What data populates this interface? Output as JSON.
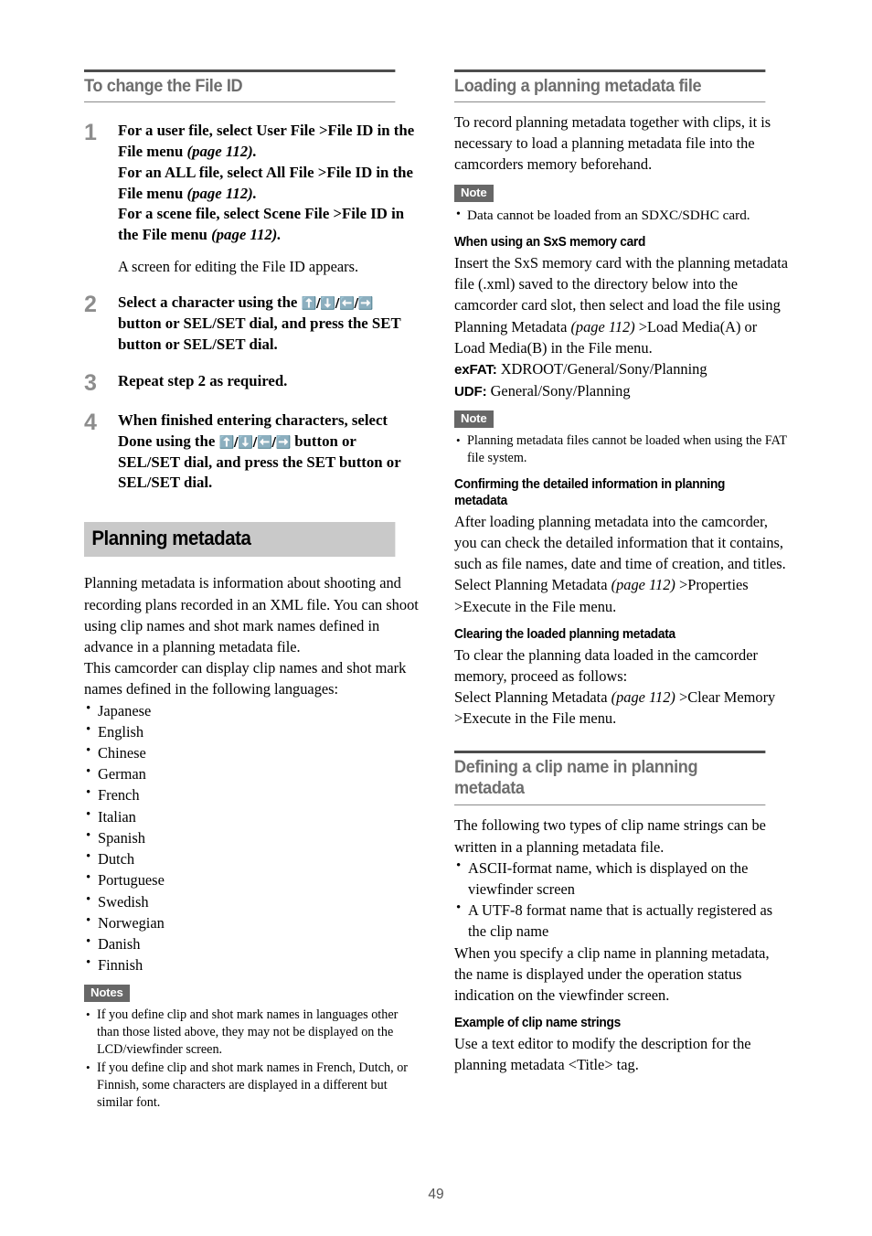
{
  "page": {
    "number": "49"
  },
  "left_column": {
    "heading": "To change the File ID",
    "steps": [
      {
        "num": "1",
        "lines": [
          "For a user file, select User File >File ID in the File menu ",
          "(page 112).",
          "For an ALL file, select All File >File ID in the File menu ",
          "(page 112).",
          "For a scene file, select Scene File >File ID in the File menu ",
          "(page 112)."
        ],
        "note": "A screen for editing the File ID appears."
      },
      {
        "num": "2",
        "text_before_arrows": "Select a character using the ",
        "arrows": "✦/✧/✦/✧",
        "text_after_arrows": " button or SEL/SET dial, and press the SET button or SEL/SET dial."
      },
      {
        "num": "3",
        "text": "Repeat step 2 as required."
      },
      {
        "num": "4",
        "text_before_arrows": "When finished entering characters, select Done using the ",
        "arrows": "✦/✧/✦/✧",
        "text_after_arrows": " button or SEL/SET dial, and press the SET button or SEL/SET dial."
      }
    ],
    "band_heading": "Planning metadata",
    "intro_paragraph_1": "Planning metadata is information about shooting and recording plans recorded in an XML file. You can shoot using clip names and shot mark names defined in advance in a planning metadata file.",
    "intro_paragraph_2": "This camcorder can display clip names and shot mark names defined in the following languages:",
    "languages": [
      "Japanese",
      "English",
      "Chinese",
      "German",
      "French",
      "Italian",
      "Spanish",
      "Dutch",
      "Portuguese",
      "Swedish",
      "Norwegian",
      "Danish",
      "Finnish"
    ],
    "notes_badge": "Notes",
    "notes": [
      "If you define clip and shot mark names in languages other than those listed above, they may not be displayed on the LCD/viewfinder screen.",
      "If you define clip and shot mark names in French, Dutch, or Finnish, some characters are displayed in a different but similar font."
    ]
  },
  "right_column": {
    "heading_loading": "Loading a planning metadata file",
    "loading_intro": "To record planning metadata together with clips, it is necessary to load a planning metadata file into the camcorders memory beforehand.",
    "note_badge_1": "Note",
    "note_1": "Data cannot be loaded from an SDXC/SDHC card.",
    "subhead_sxs": "When using an SxS memory card",
    "sxs_text_1": "Insert the SxS memory card with the planning metadata file (.xml) saved to the directory below into the camcorder card slot, then select and load the file using Planning Metadata ",
    "sxs_page_ref": "(page 112)",
    "sxs_text_2": " >Load Media(A) or Load Media(B) in the File menu.",
    "exfat_label": "exFAT:",
    "exfat_path": " XDROOT/General/Sony/Planning",
    "udf_label": "UDF:",
    "udf_path": " General/Sony/Planning",
    "note_badge_2": "Note",
    "note_2": "Planning metadata files cannot be loaded when using the FAT file system.",
    "subhead_confirming": "Confirming the detailed information in planning metadata",
    "confirming_text_1": "After loading planning metadata into the camcorder, you can check the detailed information that it contains, such as file names, date and time of creation, and titles.",
    "confirming_text_2": "Select Planning Metadata ",
    "confirming_page_ref": "(page 112)",
    "confirming_text_3": " >Properties >Execute in the File menu.",
    "subhead_clearing": "Clearing the loaded planning metadata",
    "clearing_text_1": "To clear the planning data loaded in the camcorder memory, proceed as follows:",
    "clearing_text_2": "Select Planning Metadata ",
    "clearing_page_ref": "(page 112)",
    "clearing_text_3": " >Clear Memory >Execute in the File menu.",
    "heading_defining": "Defining a clip name in planning metadata",
    "defining_intro": "The following two types of clip name strings can be written in a planning metadata file.",
    "defining_bullets": [
      "ASCII-format name, which is displayed on the viewfinder screen",
      "A UTF-8 format name that is actually registered as the clip name"
    ],
    "defining_text_2": "When you specify a clip name in planning metadata, the name is displayed under the operation status indication on the viewfinder screen.",
    "subhead_example": "Example of clip name strings",
    "example_text": "Use a text editor to modify the description for the planning metadata <Title> tag."
  }
}
